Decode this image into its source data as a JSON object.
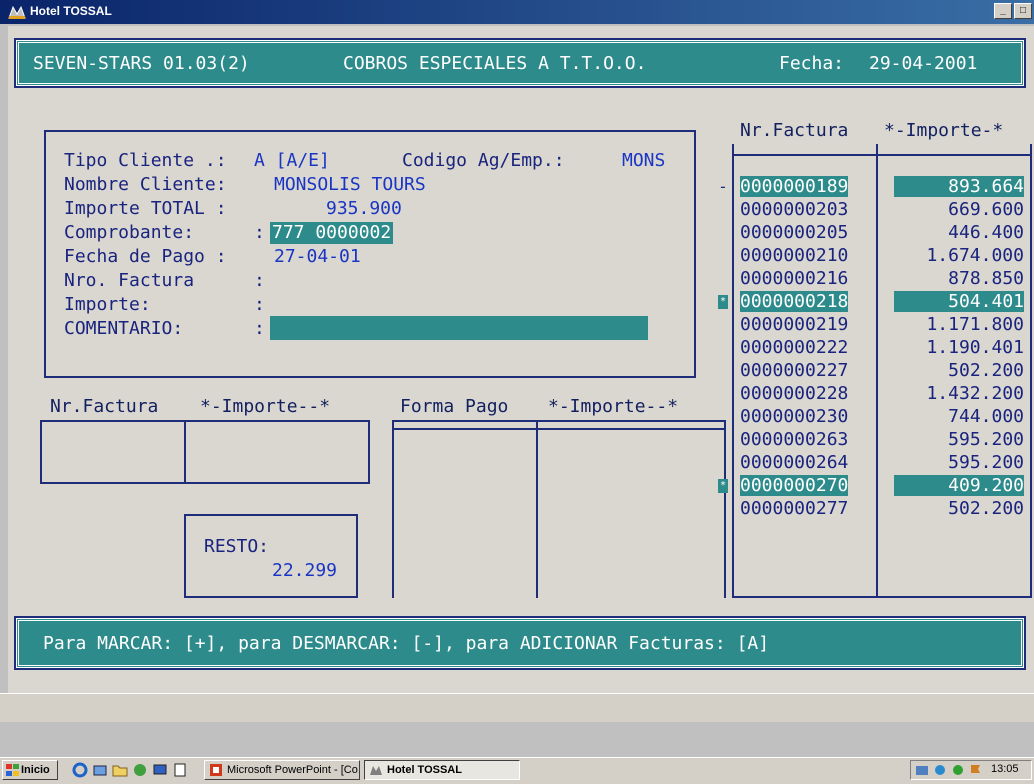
{
  "window": {
    "title": "Hotel TOSSAL",
    "controls": [
      "_",
      "□"
    ]
  },
  "header": {
    "system": "SEVEN-STARS 01.03(2)",
    "screen_title": "COBROS ESPECIALES A T.T.O.O.",
    "date_label": "Fecha:",
    "date_value": "29-04-2001"
  },
  "form": {
    "tipo_cliente_label": "Tipo Cliente .:",
    "tipo_cliente_value": "A [A/E]",
    "codigo_label": "Codigo Ag/Emp.:",
    "codigo_value": "MONS",
    "nombre_label": "Nombre Cliente:",
    "nombre_value": "MONSOLIS TOURS",
    "importe_total_label": "Importe TOTAL :",
    "importe_total_value": "935.900",
    "comprobante_label": "Comprobante:",
    "comprobante_value": "777 0000002",
    "fecha_pago_label": "Fecha de Pago :",
    "fecha_pago_value": "27-04-01",
    "nro_factura_label": "Nro. Factura",
    "importe_label": "Importe:",
    "comentario_label": "COMENTARIO:",
    "colon": ":"
  },
  "left_table": {
    "header_factura": "Nr.Factura",
    "header_importe": "*-Importe--*"
  },
  "pay_table": {
    "header_forma": "Forma Pago",
    "header_importe": "*-Importe--*"
  },
  "resto": {
    "label": "RESTO:",
    "value": "22.299"
  },
  "invoices": {
    "header_factura": "Nr.Factura",
    "header_importe": "*-Importe-*",
    "rows": [
      {
        "numero": "0000000189",
        "importe": "893.664",
        "selected": true,
        "marker": "-"
      },
      {
        "numero": "0000000203",
        "importe": "669.600",
        "selected": false,
        "marker": ""
      },
      {
        "numero": "0000000205",
        "importe": "446.400",
        "selected": false,
        "marker": ""
      },
      {
        "numero": "0000000210",
        "importe": "1.674.000",
        "selected": false,
        "marker": ""
      },
      {
        "numero": "0000000216",
        "importe": "878.850",
        "selected": false,
        "marker": ""
      },
      {
        "numero": "0000000218",
        "importe": "504.401",
        "selected": true,
        "marker": "*"
      },
      {
        "numero": "0000000219",
        "importe": "1.171.800",
        "selected": false,
        "marker": ""
      },
      {
        "numero": "0000000222",
        "importe": "1.190.401",
        "selected": false,
        "marker": ""
      },
      {
        "numero": "0000000227",
        "importe": "502.200",
        "selected": false,
        "marker": ""
      },
      {
        "numero": "0000000228",
        "importe": "1.432.200",
        "selected": false,
        "marker": ""
      },
      {
        "numero": "0000000230",
        "importe": "744.000",
        "selected": false,
        "marker": ""
      },
      {
        "numero": "0000000263",
        "importe": "595.200",
        "selected": false,
        "marker": ""
      },
      {
        "numero": "0000000264",
        "importe": "595.200",
        "selected": false,
        "marker": ""
      },
      {
        "numero": "0000000270",
        "importe": "409.200",
        "selected": true,
        "marker": "*"
      },
      {
        "numero": "0000000277",
        "importe": "502.200",
        "selected": false,
        "marker": ""
      }
    ]
  },
  "status": {
    "help_text": "Para MARCAR: [+], para DESMARCAR: [-], para ADICIONAR Facturas: [A]"
  },
  "taskbar": {
    "start_label": "Inicio",
    "task1_label": "Microsoft PowerPoint - [Co...",
    "task2_label": "Hotel TOSSAL",
    "clock": "13:05"
  },
  "colors": {
    "teal": "#2e8b8b",
    "navy": "#1e2c7a",
    "screen_bg": "#d9d7d0"
  }
}
